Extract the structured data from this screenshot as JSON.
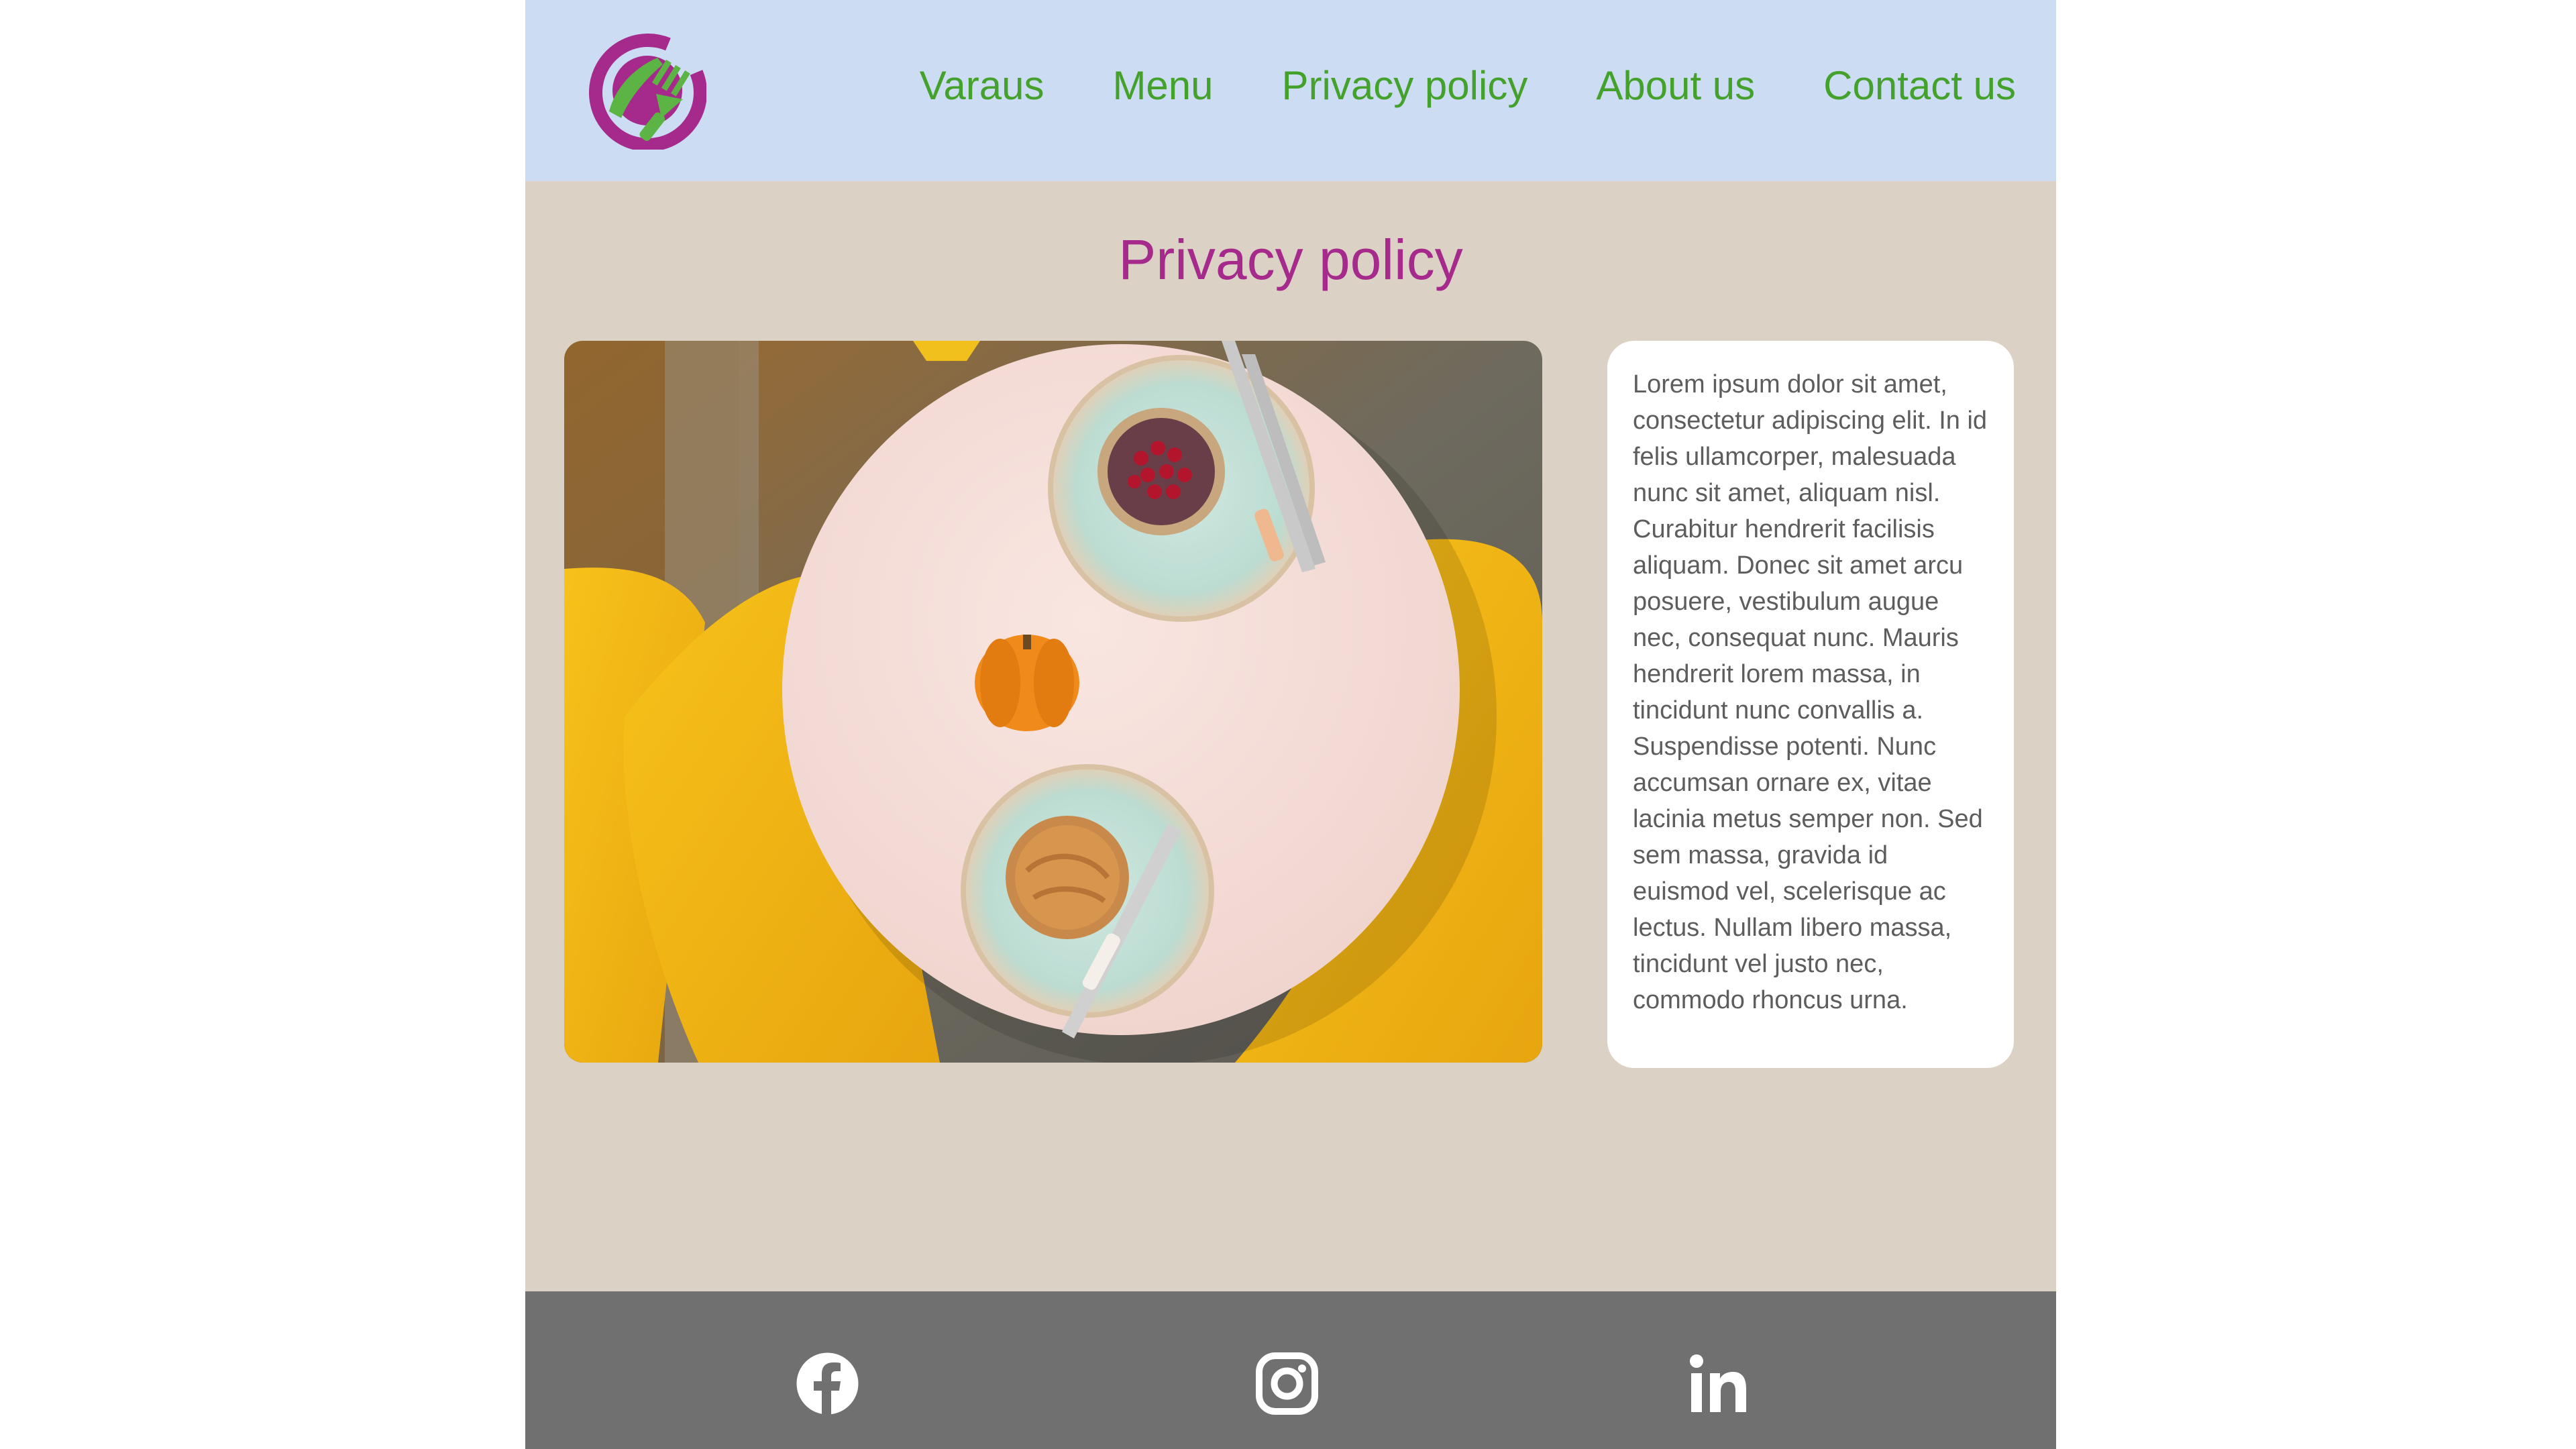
{
  "header": {
    "logo_icon": "restaurant-logo-icon",
    "nav": [
      {
        "label": "Varaus"
      },
      {
        "label": "Menu"
      },
      {
        "label": "Privacy policy"
      },
      {
        "label": "About us"
      },
      {
        "label": "Contact us"
      }
    ]
  },
  "main": {
    "title": "Privacy policy",
    "image_icon": "table-with-pastries-photo",
    "body_text": "Lorem ipsum dolor sit amet, consectetur adipiscing elit. In id felis ullamcorper, malesuada nunc sit amet, aliquam nisl. Curabitur hendrerit facilisis aliquam. Donec sit amet arcu posuere, vestibulum augue nec, consequat nunc. Mauris hendrerit lorem massa, in tincidunt nunc convallis a. Suspendisse potenti. Nunc accumsan ornare ex, vitae lacinia metus semper non. Sed sem massa, gravida id euismod vel, scelerisque ac lectus. Nullam libero massa, tincidunt vel justo nec, commodo rhoncus urna."
  },
  "footer": {
    "social": [
      {
        "icon": "facebook-icon"
      },
      {
        "icon": "instagram-icon"
      },
      {
        "icon": "linkedin-icon"
      }
    ]
  },
  "colors": {
    "header_bg": "#ccdcf2",
    "page_bg": "#dbd2c5",
    "footer_bg": "#707070",
    "nav_text": "#44a22c",
    "title_text": "#a52a8c",
    "logo_magenta": "#a52a8c",
    "logo_green": "#5bb443"
  }
}
